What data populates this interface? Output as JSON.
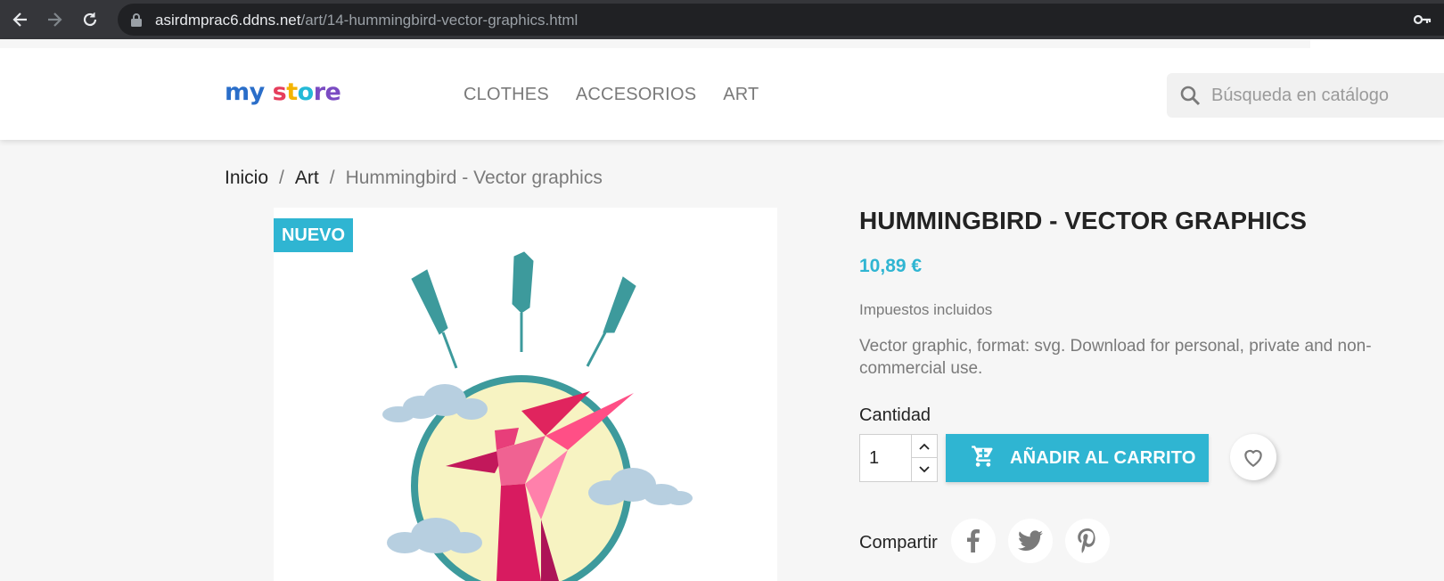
{
  "browser": {
    "url_host": "asirdmprac6.ddns.net",
    "url_path": "/art/14-hummingbird-vector-graphics.html",
    "icons": [
      "back-icon",
      "forward-icon",
      "reload-icon",
      "lock-icon",
      "key-icon"
    ]
  },
  "header": {
    "logo": {
      "part1": "my",
      "part2": "s",
      "part3": "t",
      "part4": "o",
      "part5": "re"
    },
    "menu": [
      {
        "label": "CLOTHES"
      },
      {
        "label": "ACCESORIOS"
      },
      {
        "label": "ART"
      }
    ],
    "search": {
      "placeholder": "Búsqueda en catálogo",
      "icon": "search-icon"
    }
  },
  "breadcrumb": {
    "items": [
      {
        "label": "Inicio"
      },
      {
        "label": "Art"
      },
      {
        "label": "Hummingbird - Vector graphics"
      }
    ],
    "separator": "/"
  },
  "product": {
    "badge": "NUEVO",
    "title": "HUMMINGBIRD - VECTOR GRAPHICS",
    "price": "10,89 €",
    "tax_note": "Impuestos incluidos",
    "description": "Vector graphic, format: svg. Download for personal, private and non-commercial use.",
    "quantity_label": "Cantidad",
    "quantity_value": "1",
    "add_to_cart_label": "AÑADIR AL CARRITO",
    "share_label": "Compartir",
    "share_networks": [
      "facebook-icon",
      "twitter-icon",
      "pinterest-icon"
    ]
  },
  "colors": {
    "accent": "#2fb5d2",
    "chrome_bg": "#35363a",
    "page_bg": "#f6f6f6",
    "text_muted": "#7a7a7a",
    "illustration_teal": "#3d9a9c",
    "illustration_pink": "#e0245e",
    "illustration_sun": "#f7f3c2",
    "illustration_cloud": "#b7cfe0"
  }
}
